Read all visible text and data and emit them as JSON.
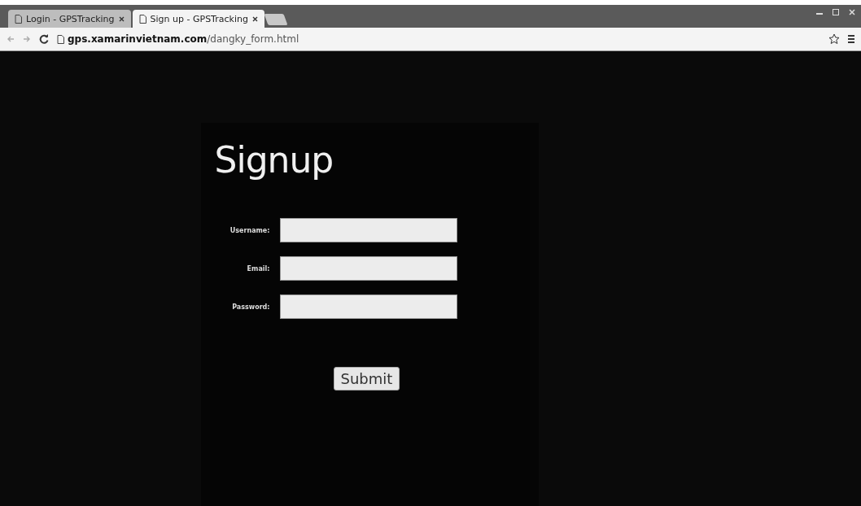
{
  "browser": {
    "tabs": [
      {
        "title": "Login - GPSTracking",
        "selected": false
      },
      {
        "title": "Sign up - GPSTracking",
        "selected": true
      }
    ],
    "url_host": "gps.xamarinvietnam.com",
    "url_path": "/dangky_form.html"
  },
  "form": {
    "title": "Signup",
    "fields": [
      {
        "label": "Username:"
      },
      {
        "label": "Email:"
      },
      {
        "label": "Password:"
      }
    ],
    "submit": "Submit"
  }
}
